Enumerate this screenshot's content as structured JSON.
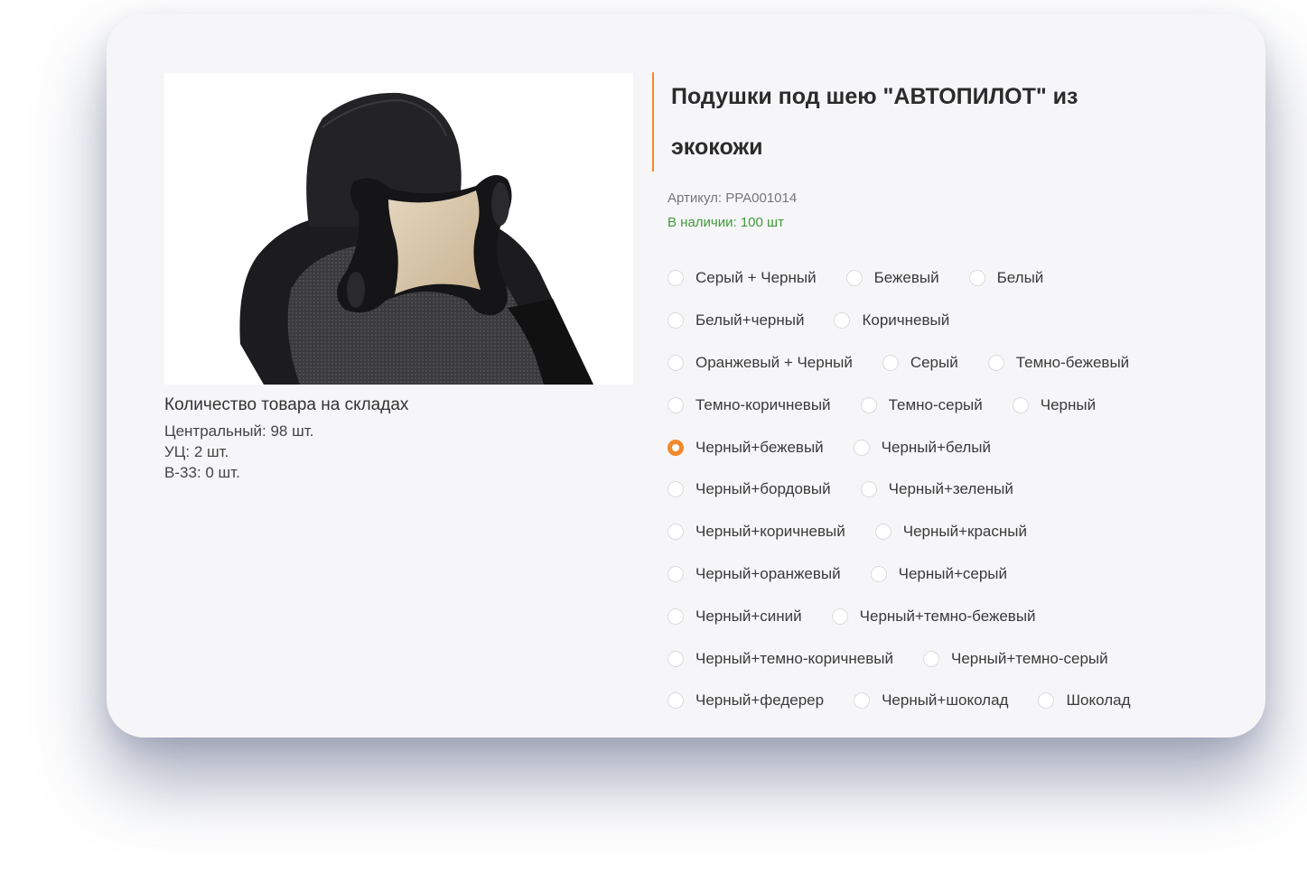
{
  "product": {
    "title": "Подушки под шею \"АВТОПИЛОТ\" из экокожи",
    "sku": "Артикул: PPA001014",
    "availability": "В наличии: 100 шт",
    "image_alt": "neck-pillow-on-car-seat",
    "accent_color": "#f08a2c",
    "availability_color": "#3f9a3a"
  },
  "stock": {
    "title": "Количество товара на складах",
    "lines": [
      "Центральный: 98 шт.",
      "УЦ: 2 шт.",
      "В-33: 0 шт."
    ]
  },
  "colors": {
    "selected": "Черный+бежевый",
    "rows": [
      [
        "Серый + Черный",
        "Бежевый",
        "Белый"
      ],
      [
        "Белый+черный",
        "Коричневый"
      ],
      [
        "Оранжевый + Черный",
        "Серый",
        "Темно-бежевый"
      ],
      [
        "Темно-коричневый",
        "Темно-серый",
        "Черный"
      ],
      [
        "Черный+бежевый",
        "Черный+белый"
      ],
      [
        "Черный+бордовый",
        "Черный+зеленый"
      ],
      [
        "Черный+коричневый",
        "Черный+красный"
      ],
      [
        "Черный+оранжевый",
        "Черный+серый"
      ],
      [
        "Черный+синий",
        "Черный+темно-бежевый"
      ],
      [
        "Черный+темно-коричневый",
        "Черный+темно-серый"
      ],
      [
        "Черный+федерер",
        "Черный+шоколад",
        "Шоколад"
      ]
    ]
  }
}
